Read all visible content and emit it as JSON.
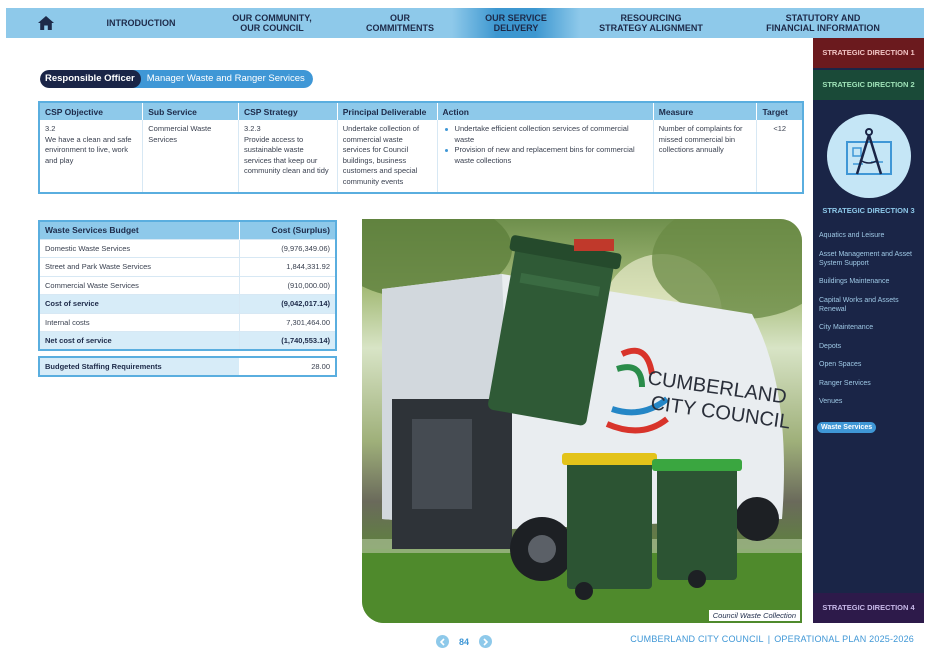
{
  "nav": {
    "home_icon": "home-icon",
    "items": [
      "INTRODUCTION",
      "OUR COMMUNITY,\nOUR COUNCIL",
      "OUR\nCOMMITMENTS",
      "OUR SERVICE\nDELIVERY",
      "RESOURCING\nSTRATEGY ALIGNMENT",
      "STATUTORY AND\nFINANCIAL INFORMATION"
    ],
    "active_index": 3
  },
  "officer": {
    "label": "Responsible Officer",
    "value": "Manager Waste and Ranger Services"
  },
  "csp_table": {
    "headers": [
      "CSP Objective",
      "Sub Service",
      "CSP Strategy",
      "Principal Deliverable",
      "Action",
      "Measure",
      "Target"
    ],
    "row": {
      "objective_code": "3.2",
      "objective_text": "We have a clean and safe environment to live, work and play",
      "sub_service": "Commercial Waste Services",
      "strategy_code": "3.2.3",
      "strategy_text": "Provide access to sustainable waste services that keep our community clean and tidy",
      "deliverable": "Undertake collection of commercial waste services for Council buildings, business customers and special community events",
      "actions": [
        "Undertake efficient collection services of commercial waste",
        "Provision of new and replacement bins for commercial waste collections"
      ],
      "measure": "Number of complaints for missed commercial bin collections annually",
      "target": "<12"
    }
  },
  "budget": {
    "header_label": "Waste Services Budget",
    "header_value": "Cost (Surplus)",
    "rows": [
      {
        "label": "Domestic Waste Services",
        "value": "(9,976,349.06)",
        "bold": false
      },
      {
        "label": "Street and Park Waste Services",
        "value": "1,844,331.92",
        "bold": false
      },
      {
        "label": "Commercial Waste Services",
        "value": "(910,000.00)",
        "bold": false
      },
      {
        "label": "Cost of service",
        "value": "(9,042,017.14)",
        "bold": true
      },
      {
        "label": "Internal costs",
        "value": "7,301,464.00",
        "bold": false
      },
      {
        "label": "Net cost of service",
        "value": "(1,740,553.14)",
        "bold": true
      }
    ]
  },
  "staffing": {
    "label": "Budgeted Staffing Requirements",
    "value": "28.00"
  },
  "photo": {
    "caption": "Council Waste Collection",
    "truck_text_1": "CUMBERLAND",
    "truck_text_2": "CITY COUNCIL"
  },
  "sidebar": {
    "direction_1": "STRATEGIC DIRECTION 1",
    "direction_2": "STRATEGIC DIRECTION 2",
    "direction_3": "STRATEGIC DIRECTION 3",
    "direction_4": "STRATEGIC DIRECTION 4",
    "direction_3_icon": "compass-blueprint-icon",
    "items": [
      "Aquatics and Leisure",
      "Asset Management and Asset System Support",
      "Buildings Maintenance",
      "Capital Works and Assets Renewal",
      "City Maintenance",
      "Depots",
      "Open Spaces",
      "Ranger Services",
      "Venues",
      "Waste Services"
    ],
    "active_item": "Waste Services"
  },
  "footer": {
    "page_number": "84",
    "brand": "CUMBERLAND CITY COUNCIL",
    "separator": "|",
    "plan": "OPERATIONAL PLAN 2025-2026"
  },
  "colors": {
    "nav_bg": "#8ec9ea",
    "nav_active": "#3d97d0",
    "dark_navy": "#1a2547",
    "accent_blue": "#3f97d6",
    "direction_1": "#6b1a1e",
    "direction_2": "#1a4a38",
    "direction_4": "#2d1a4a"
  }
}
